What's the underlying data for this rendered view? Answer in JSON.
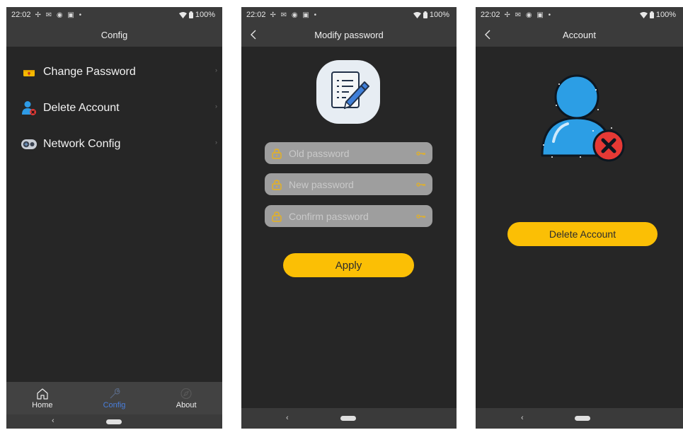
{
  "status_bar": {
    "time": "22:02",
    "battery": "100%"
  },
  "config_screen": {
    "title": "Config",
    "menu": [
      {
        "label": "Change Password",
        "icon": "password-lock-icon"
      },
      {
        "label": "Delete Account",
        "icon": "delete-user-icon"
      },
      {
        "label": "Network Config",
        "icon": "network-icon"
      }
    ],
    "bottom_nav": [
      {
        "label": "Home",
        "icon": "home-icon",
        "active": false
      },
      {
        "label": "Config",
        "icon": "wrench-icon",
        "active": true
      },
      {
        "label": "About",
        "icon": "compass-icon",
        "active": false
      }
    ]
  },
  "modify_password_screen": {
    "title": "Modify password",
    "fields": {
      "old": {
        "placeholder": "Old password"
      },
      "new": {
        "placeholder": "New password"
      },
      "confirm": {
        "placeholder": "Confirm password"
      }
    },
    "apply_label": "Apply"
  },
  "account_screen": {
    "title": "Account",
    "delete_label": "Delete Account"
  },
  "colors": {
    "background": "#262626",
    "bar": "#3b3b3b",
    "accent": "#fbbf05",
    "nav_active": "#4a7fdc",
    "field": "#9e9e9e"
  }
}
